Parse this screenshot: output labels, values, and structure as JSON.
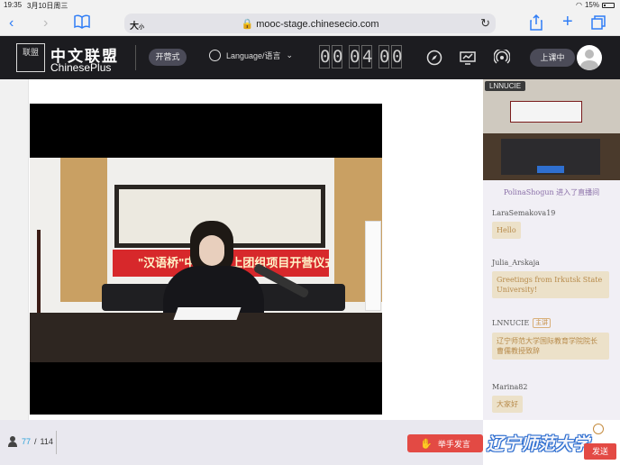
{
  "status_bar": {
    "time": "19:35",
    "date": "3月10日周三",
    "battery": "15%"
  },
  "browser": {
    "text_size_label": "大",
    "text_size_small": "小",
    "url": "mooc-stage.chinesecio.com",
    "back_icon": "‹",
    "forward_icon": "›",
    "bookmarks_icon": "book-icon",
    "share_icon": "share-icon",
    "new_tab_icon": "+",
    "tabs_icon": "tabs-icon",
    "reload_icon": "↻"
  },
  "header": {
    "logo_mark": "联盟",
    "logo_cn": "中文联盟",
    "logo_en": "ChinesePlus",
    "mode_label": "开营式",
    "language_label": "Language/语言",
    "timer_digits": [
      "0",
      "0",
      "0",
      "4",
      "0",
      "0"
    ],
    "class_button": "上课中"
  },
  "video": {
    "banner_text": "\"汉语桥\"中俄青年上团组项目开营仪式"
  },
  "sidebar": {
    "camera_badge": "LNNUCIE",
    "system_message": "PolinaShogun 进入了直播间",
    "messages": [
      {
        "name": "LaraSemakova19",
        "text": "Hello"
      },
      {
        "name": "Julia_Arskaja",
        "text": "Greetings from Irkutsk State University!"
      },
      {
        "name": "LNNUCIE",
        "tag": "主讲",
        "text": "辽宁师范大学国际教育学院院长 曹儒教授致辞"
      },
      {
        "name": "Marina82",
        "text": "大家好"
      }
    ]
  },
  "bottom": {
    "online_count": "77",
    "total_count": "114",
    "raise_hand_label": "举手发言",
    "send_label": "发送",
    "watermark": "辽宁师范大学"
  },
  "colors": {
    "header_bg": "#1c1c20",
    "accent_red": "#e34a44",
    "bubble_bg": "#ece1c9",
    "link_blue": "#2f7df6"
  }
}
